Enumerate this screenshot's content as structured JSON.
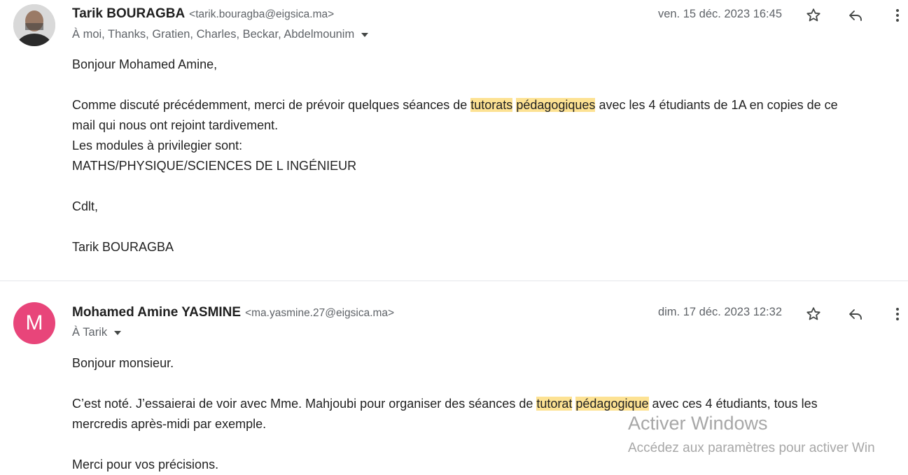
{
  "messages": [
    {
      "sender_name": "Tarik BOURAGBA",
      "sender_email": "<tarik.bouragba@eigsica.ma>",
      "recipients": "À moi, Thanks, Gratien, Charles, Beckar, Abdelmounim",
      "date": "ven. 15 déc. 2023 16:45",
      "body": {
        "greeting": "Bonjour Mohamed Amine,",
        "p1_before": "Comme discuté précédemment, merci de prévoir quelques séances de ",
        "p1_hl1": "tutorats",
        "p1_hl2": "pédagogiques",
        "p1_after": " avec les 4 étudiants de 1A en copies de ce",
        "p1_line2": "mail qui nous ont rejoint tardivement.",
        "p1_line3": "Les modules à privilegier sont:",
        "p1_line4": "MATHS/PHYSIQUE/SCIENCES DE L INGÉNIEUR",
        "closing": "Cdlt,",
        "signature": "Tarik BOURAGBA"
      }
    },
    {
      "avatar_letter": "M",
      "sender_name": "Mohamed Amine YASMINE",
      "sender_email": "<ma.yasmine.27@eigsica.ma>",
      "recipients": "À Tarik",
      "date": "dim. 17 déc. 2023 12:32",
      "body": {
        "greeting": "Bonjour monsieur.",
        "p1_before": "C’est noté. J’essaierai de voir avec Mme. Mahjoubi pour organiser des séances de ",
        "p1_hl1": "tutorat",
        "p1_hl2": "pédagogique",
        "p1_after": " avec ces 4 étudiants, tous les",
        "p1_line2": "mercredis après-midi par exemple.",
        "closing": "Merci pour vos précisions."
      }
    }
  ],
  "watermark": {
    "title": "Activer Windows",
    "subtitle": "Accédez aux paramètres pour activer Win"
  },
  "icons": [
    "star-icon",
    "reply-icon",
    "more-vert-icon",
    "caret-down-icon"
  ],
  "colors": {
    "highlight": "#fde293",
    "avatar_m": "#e8457a"
  }
}
